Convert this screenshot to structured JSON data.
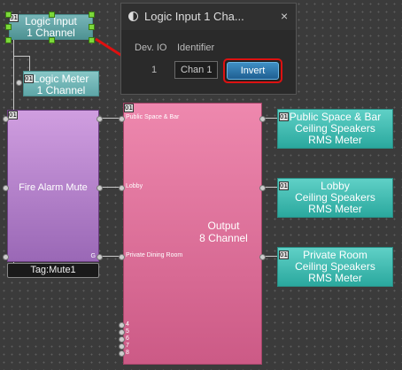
{
  "logic_input": {
    "line1": "Logic Input",
    "line2": "1 Channel",
    "badge": "01"
  },
  "logic_meter": {
    "line1": "Logic Meter",
    "line2": "1 Channel",
    "badge": "01"
  },
  "fire_alarm": {
    "label": "Fire Alarm Mute",
    "badge": "01",
    "port_g": "G",
    "tag": "Tag:Mute1"
  },
  "output": {
    "line1": "Output",
    "line2": "8 Channel",
    "badge": "01",
    "ports": [
      "Public Space & Bar",
      "Lobby",
      "Private Dining Room"
    ],
    "extra_ports": [
      "4",
      "5",
      "6",
      "7",
      "8"
    ]
  },
  "meters": [
    {
      "line1": "Public Space & Bar",
      "line2": "Ceiling Speakers",
      "line3": "RMS Meter",
      "badge": "01"
    },
    {
      "line1": "Lobby",
      "line2": "Ceiling Speakers",
      "line3": "RMS Meter",
      "badge": "01"
    },
    {
      "line1": "Private Room",
      "line2": "Ceiling Speakers",
      "line3": "RMS Meter",
      "badge": "01"
    }
  ],
  "dialog": {
    "title": "Logic Input 1 Cha...",
    "col_devio": "Dev. IO",
    "col_identifier": "Identifier",
    "row_number": "1",
    "identifier_value": "Chan 1",
    "invert_label": "Invert",
    "pin_icon": "pin-icon",
    "close_icon": "close-icon",
    "highlight_color": "#dd1111"
  },
  "colors": {
    "canvas": "#3b3b3b",
    "logic": "#6ab0b1",
    "fire_alarm": "#a070b8",
    "output": "#e06c98",
    "meter": "#2aa89e"
  }
}
